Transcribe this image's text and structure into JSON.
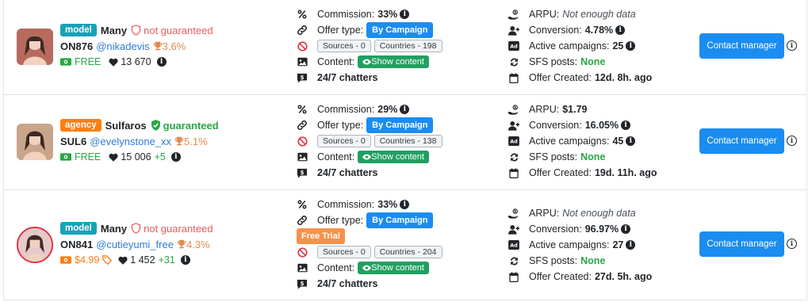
{
  "rows": [
    {
      "avatar_color": "#b86a5e",
      "avatar_round": false,
      "type_label": "model",
      "name": "Many",
      "guarantee": "not guaranteed",
      "guaranteed": false,
      "code": "ON876",
      "handle": "@nikadevis",
      "rate": "3.6%",
      "price_label": "FREE",
      "is_free": true,
      "likes": "13 670",
      "likes_plus": "",
      "commission": "33%",
      "offer_type": "By Campaign",
      "free_trial": "",
      "sources": "Sources - 0",
      "countries": "Countries - 198",
      "show_content": "Show content",
      "chatters": "24/7 chatters",
      "arpu_value": "Not enough data",
      "arpu_missing": true,
      "conversion": "4.78%",
      "active_campaigns": "25",
      "sfs_posts": "None",
      "offer_created": "12d. 8h. ago",
      "contact_label": "Contact manager"
    },
    {
      "avatar_color": "#c9a58c",
      "avatar_round": false,
      "type_label": "agency",
      "name": "Sulfaros",
      "guarantee": "guaranteed",
      "guaranteed": true,
      "code": "SUL6",
      "handle": "@evelynstone_xx",
      "rate": "5.1%",
      "price_label": "FREE",
      "is_free": true,
      "likes": "15 006",
      "likes_plus": "+5",
      "commission": "29%",
      "offer_type": "By Campaign",
      "free_trial": "",
      "sources": "Sources - 0",
      "countries": "Countries - 138",
      "show_content": "Show content",
      "chatters": "24/7 chatters",
      "arpu_value": "$1.79",
      "arpu_missing": false,
      "conversion": "16.05%",
      "active_campaigns": "45",
      "sfs_posts": "None",
      "offer_created": "19d. 11h. ago",
      "contact_label": "Contact manager"
    },
    {
      "avatar_color": "#e8c9c9",
      "avatar_round": true,
      "type_label": "model",
      "name": "Many",
      "guarantee": "not guaranteed",
      "guaranteed": false,
      "code": "ON841",
      "handle": "@cutieyumi_free",
      "rate": "4.3%",
      "price_label": "$4.99",
      "is_free": false,
      "likes": "1 452",
      "likes_plus": "+31",
      "commission": "33%",
      "offer_type": "By Campaign",
      "free_trial": "Free Trial",
      "sources": "Sources - 0",
      "countries": "Countries - 204",
      "show_content": "Show content",
      "chatters": "24/7 chatters",
      "arpu_value": "Not enough data",
      "arpu_missing": true,
      "conversion": "96.97%",
      "active_campaigns": "27",
      "sfs_posts": "None",
      "offer_created": "27d. 5h. ago",
      "contact_label": "Contact manager"
    }
  ],
  "labels": {
    "commission": "Commission:",
    "offer_type": "Offer type:",
    "content": "Content:",
    "arpu": "ARPU:",
    "conversion": "Conversion:",
    "active_campaigns": "Active campaigns:",
    "sfs_posts": "SFS posts:",
    "offer_created": "Offer Created:"
  },
  "icons": {
    "percent": "percent-icon",
    "link": "link-icon",
    "ban": "ban-icon",
    "image": "image-icon",
    "chat": "chat-money-icon",
    "arpu": "hand-coin-icon",
    "user_plus": "user-plus-icon",
    "ad": "ad-icon",
    "sync": "sync-icon",
    "calendar": "calendar-icon"
  }
}
